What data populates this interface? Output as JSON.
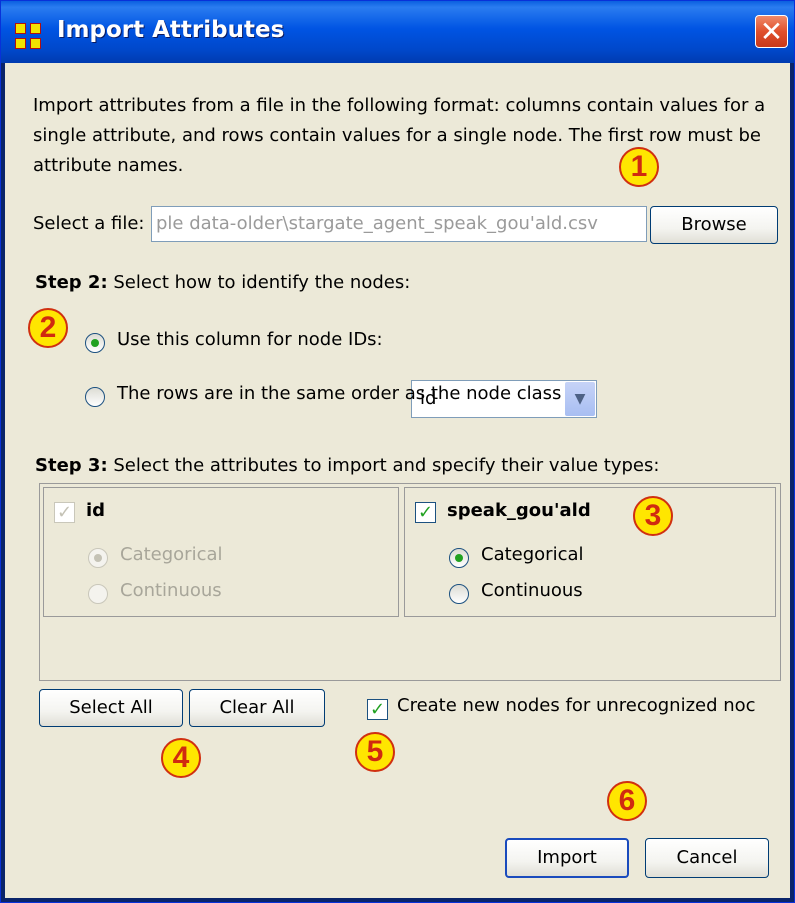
{
  "window": {
    "title": "Import Attributes",
    "close_glyph": "✕",
    "app_icon": "grid-icon"
  },
  "description": "Import attributes from a file in the following format: columns contain values for a single attribute, and rows contain values for a single node. The first row must be attribute names.",
  "file": {
    "label": "Select a file:",
    "value": "ple data-older\\stargate_agent_speak_gou'ald.csv",
    "browse_label": "Browse"
  },
  "step2": {
    "title_bold": "Step 2:",
    "title_rest": " Select how to identify the nodes:",
    "option1_label": "Use this column for node IDs:",
    "option1_selected": true,
    "column_value": "id",
    "option2_label": "The rows are in the same order as the node class",
    "option2_selected": false
  },
  "step3": {
    "title_bold": "Step 3:",
    "title_rest": " Select the attributes to import and specify their value types:",
    "attributes": [
      {
        "name": "id",
        "checked": true,
        "enabled": false,
        "option1": "Categorical",
        "option2": "Continuous",
        "selected": "Categorical"
      },
      {
        "name": "speak_gou'ald",
        "checked": true,
        "enabled": true,
        "option1": "Categorical",
        "option2": "Continuous",
        "selected": "Categorical"
      }
    ]
  },
  "buttons": {
    "select_all": "Select All",
    "clear_all": "Clear All",
    "import": "Import",
    "cancel": "Cancel"
  },
  "create_nodes": {
    "label": "Create new nodes for unrecognized noc",
    "checked": true
  },
  "check_glyph": "✓",
  "markers": [
    "1",
    "2",
    "3",
    "4",
    "5",
    "6"
  ],
  "colors": {
    "marker_fill": "#ffe600",
    "marker_text": "#d02a10",
    "titlebar": "#0054e3",
    "dialog_bg": "#ece9d8"
  }
}
